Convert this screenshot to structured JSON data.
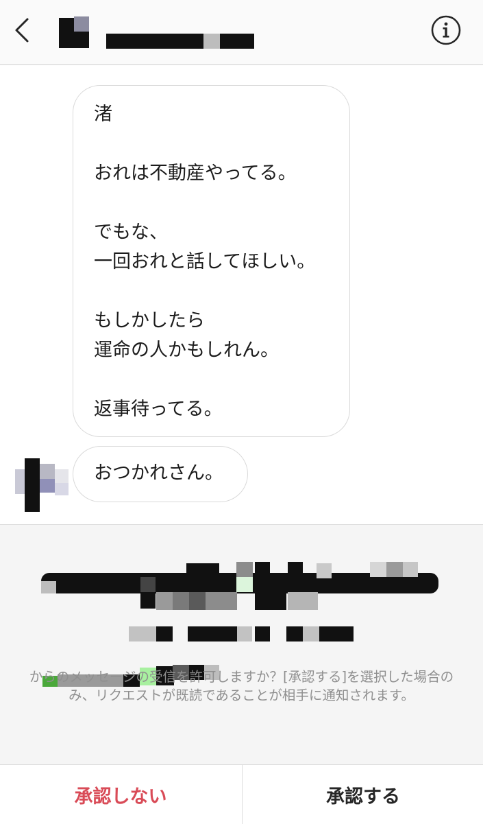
{
  "header": {
    "back_icon": "chevron-left-icon",
    "info_icon": "info-icon"
  },
  "messages": [
    {
      "lines": [
        "渚",
        "",
        "おれは不動産やってる。",
        "",
        "でもな、",
        "一回おれと話してほしい。",
        "",
        "もしかしたら",
        "運命の人かもしれん。",
        "",
        "返事待ってる。"
      ]
    },
    {
      "text": "おつかれさん。"
    }
  ],
  "request": {
    "notice_line_1": "からのメッセージの受信を許可しますか？[承認する]を選択した場合のみ、リクエストが既読であることが相手に通知されます。"
  },
  "actions": {
    "decline_label": "承認しない",
    "accept_label": "承認する"
  },
  "colors": {
    "decline": "#d94b57",
    "accept": "#262626",
    "panel_bg": "#f5f5f5"
  }
}
